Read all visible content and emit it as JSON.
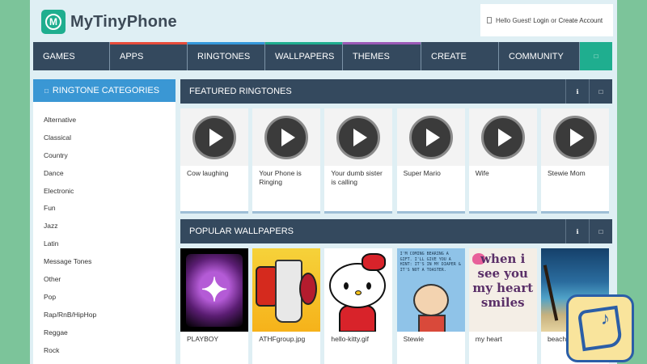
{
  "logo": {
    "mark": "M",
    "text": "MyTinyPhone"
  },
  "account": {
    "greeting": "Hello Guest!",
    "login": "Login",
    "or": "or",
    "create": "Create Account"
  },
  "nav": {
    "items": [
      {
        "label": "GAMES",
        "color": "#34495e"
      },
      {
        "label": "APPS",
        "color": "#e74c3c"
      },
      {
        "label": "RINGTONES",
        "color": "#3498db"
      },
      {
        "label": "WALLPAPERS",
        "color": "#1fae8f"
      },
      {
        "label": "THEMES",
        "color": "#9b59b6"
      },
      {
        "label": "CREATE",
        "color": "#34495e"
      },
      {
        "label": "COMMUNITY",
        "color": "#34495e"
      }
    ],
    "search_icon": "search-icon"
  },
  "sidebar": {
    "title": "RINGTONE CATEGORIES",
    "items": [
      "Alternative",
      "Classical",
      "Country",
      "Dance",
      "Electronic",
      "Fun",
      "Jazz",
      "Latin",
      "Message Tones",
      "Other",
      "Pop",
      "Rap/RnB/HipHop",
      "Reggae",
      "Rock"
    ]
  },
  "featured": {
    "title": "FEATURED RINGTONES",
    "ringtones": [
      "Cow laughing",
      "Your Phone is Ringing",
      "Your dumb sister is calling",
      "Super Mario",
      "Wife",
      "Stewie Mom"
    ]
  },
  "popular": {
    "title": "POPULAR WALLPAPERS",
    "wallpapers": [
      "PLAYBOY",
      "ATHFgroup.jpg",
      "hello-kitty.gif",
      "Stewie",
      "my heart",
      "beach"
    ],
    "stewie_text": "I'M COMING BEARING A GIFT. I'LL GIVE YOU A HINT: IT'S IN MY DIAPER & IT'S NOT A TOASTER.",
    "heart_text": "when i see you my heart smiles"
  },
  "colors": {
    "accent": "#1fae8f",
    "nav_bg": "#34495e",
    "sidebar_head": "#3a97d4",
    "page_bg": "#7cc49a"
  }
}
